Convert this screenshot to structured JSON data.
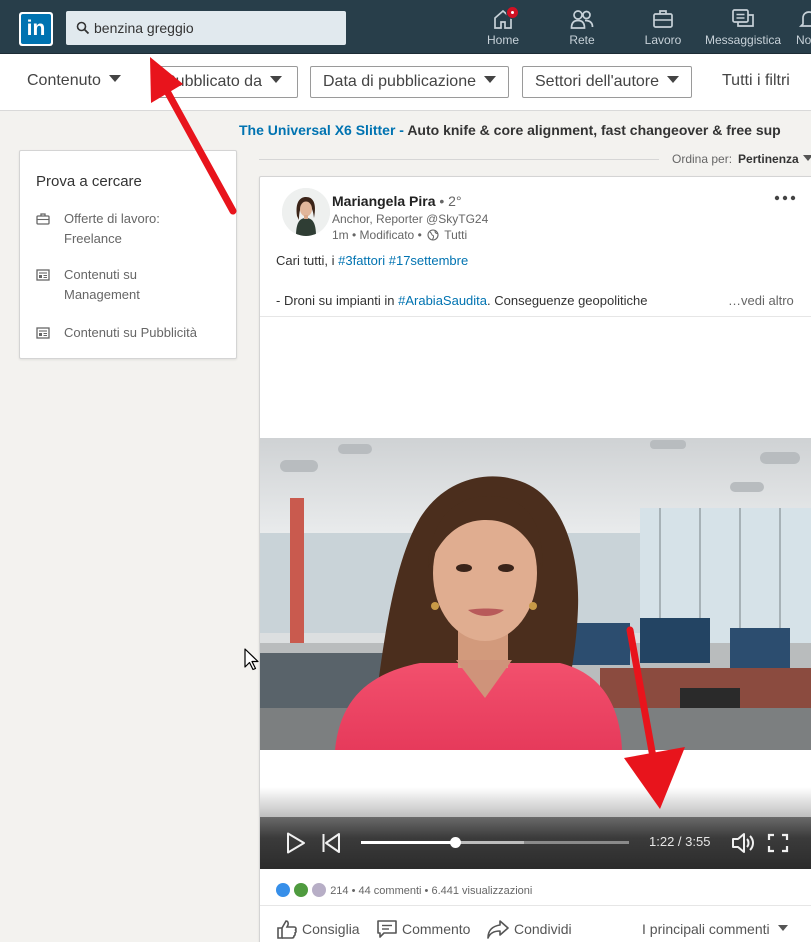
{
  "nav": {
    "logo_text": "in",
    "search_value": "benzina greggio",
    "items": [
      {
        "label": "Home",
        "icon": "home-icon",
        "has_badge": true
      },
      {
        "label": "Rete",
        "icon": "people-icon"
      },
      {
        "label": "Lavoro",
        "icon": "briefcase-icon"
      },
      {
        "label": "Messaggistica",
        "icon": "messaging-icon"
      },
      {
        "label": "No",
        "icon": "bell-icon"
      }
    ]
  },
  "filters": {
    "content": "Contenuto",
    "published_by": "Pubblicato da",
    "date": "Data di pubblicazione",
    "sectors": "Settori dell'autore",
    "all": "Tutti i filtri"
  },
  "ad": {
    "brand": "The Universal X6 Slitter -",
    "text": " Auto knife & core alignment, fast changeover & free sup"
  },
  "sort": {
    "label": "Ordina per:",
    "value": "Pertinenza"
  },
  "suggestions": {
    "title": "Prova a cercare",
    "items": [
      {
        "line1": "Offerte di lavoro:",
        "line2": "Freelance",
        "icon": "briefcase-icon"
      },
      {
        "line1": "Contenuti su",
        "line2": "Management",
        "icon": "article-icon"
      },
      {
        "line1": "Contenuti su Pubblicità",
        "line2": "",
        "icon": "article-icon"
      }
    ]
  },
  "post": {
    "author": "Mariangela Pira",
    "degree": " • 2°",
    "headline": "Anchor, Reporter @SkyTG24",
    "meta_time": "1m • Modificato •",
    "meta_visibility": "Tutti",
    "text_prefix": "Cari tutti, i ",
    "tag1": "#3fattori",
    "tag2": "#17settembre",
    "line2_prefix": "- Droni su impianti in ",
    "line2_tag": "#ArabiaSaudita",
    "line2_suffix": ". Conseguenze geopolitiche",
    "see_more": "…vedi altro",
    "video_time": "1:22 / 3:55",
    "video_progress": 0.35,
    "video_buffered": 0.61,
    "reactions_count": "214",
    "comments_count": "44 commenti",
    "views_count": "6.441 visualizzazioni",
    "action_like": "Consiglia",
    "action_comment": "Commento",
    "action_share": "Condividi",
    "comments_sort": "I principali commenti"
  },
  "colors": {
    "nav_bg": "#283e4a",
    "linkedin_blue": "#0073b1",
    "annotation_red": "#e8141c",
    "notification_red": "#d11124"
  }
}
